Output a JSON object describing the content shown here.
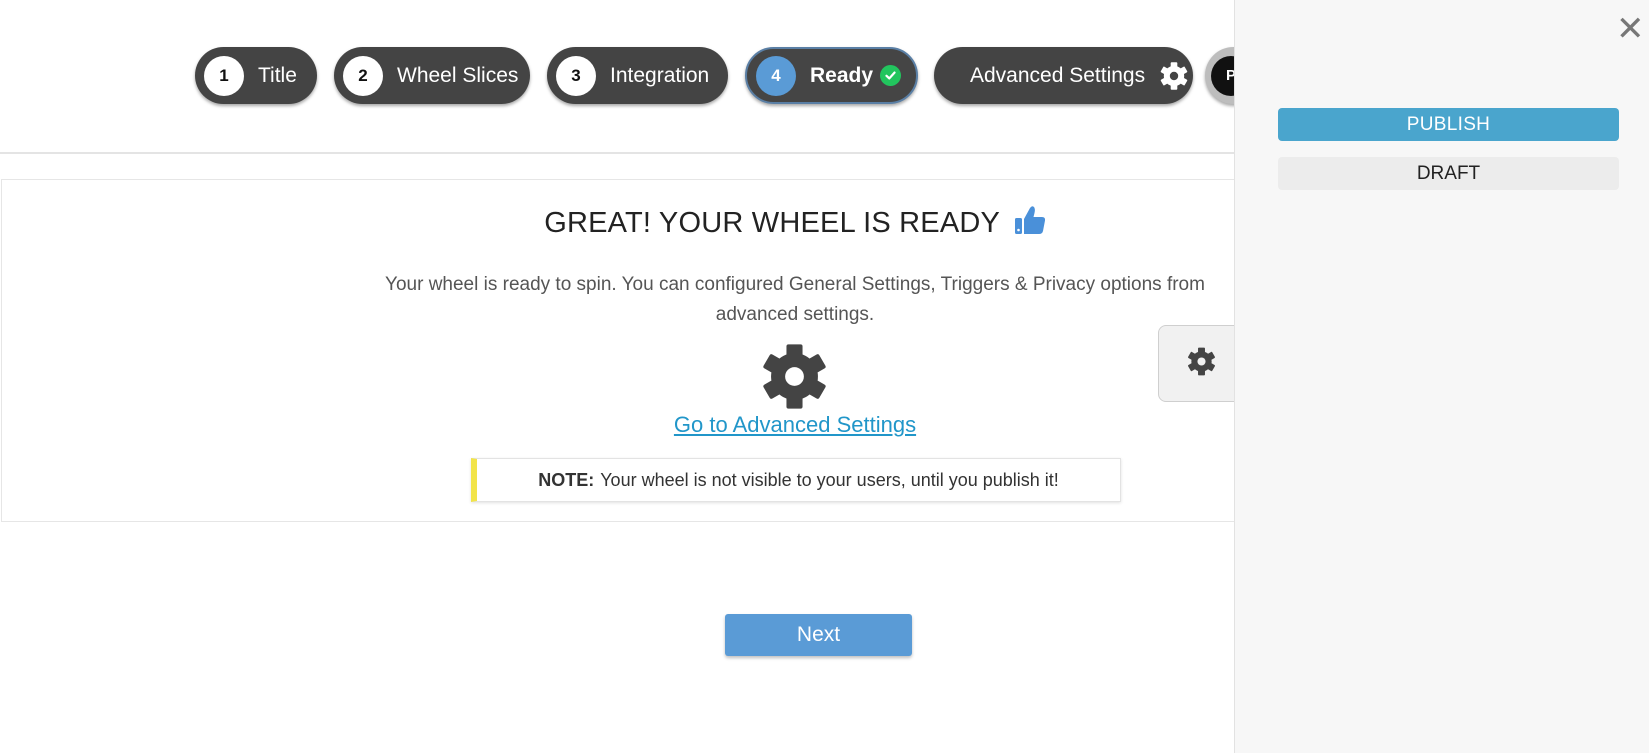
{
  "steps": [
    {
      "number": "1",
      "label": "Title"
    },
    {
      "number": "2",
      "label": "Wheel Slices"
    },
    {
      "number": "3",
      "label": "Integration"
    },
    {
      "number": "4",
      "label": "Ready"
    }
  ],
  "advanced_step": {
    "label": "Advanced Settings"
  },
  "partial_step": {
    "letter": "P"
  },
  "card": {
    "title": "GREAT! YOUR WHEEL IS READY",
    "description": "Your wheel is ready to spin. You can configured General Settings, Triggers & Privacy options from advanced settings.",
    "link": "Go to Advanced Settings",
    "note_label": "NOTE:",
    "note_text": "Your wheel is not visible to your users, until you publish it!"
  },
  "next_button": "Next",
  "panel": {
    "close_symbol": "✕",
    "publish_label": "PUBLISH",
    "draft_label": "DRAFT"
  },
  "colors": {
    "step_bg": "#444444",
    "active_step": "#5a9bd6",
    "check_green": "#22c55e",
    "link": "#2196c9",
    "publish": "#4aa5cd",
    "note_accent": "#f2e44a",
    "thumb": "#4a90d9"
  }
}
